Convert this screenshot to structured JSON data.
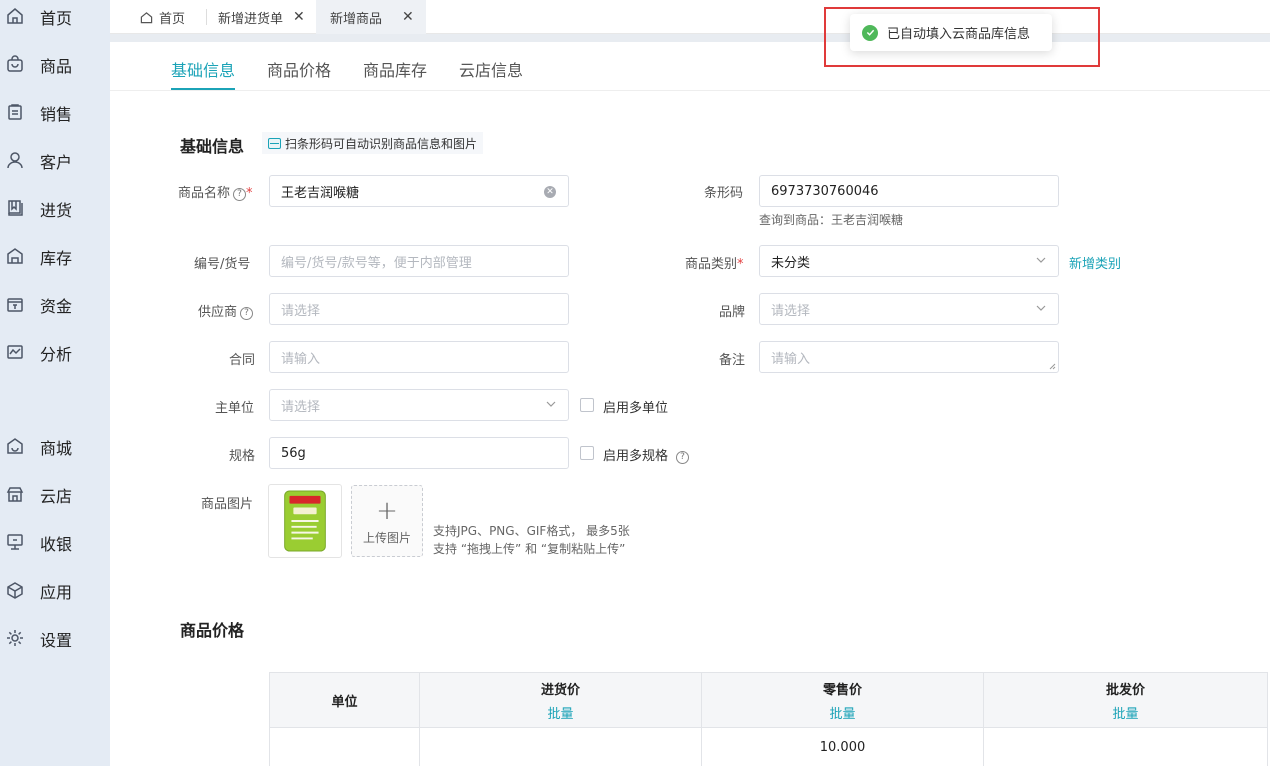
{
  "sidebar": {
    "items": [
      {
        "label": "首页",
        "icon": "home-icon"
      },
      {
        "label": "商品",
        "icon": "bag-icon"
      },
      {
        "label": "销售",
        "icon": "clipboard-icon"
      },
      {
        "label": "客户",
        "icon": "user-icon"
      },
      {
        "label": "进货",
        "icon": "book-icon"
      },
      {
        "label": "库存",
        "icon": "warehouse-icon"
      },
      {
        "label": "资金",
        "icon": "wallet-icon"
      },
      {
        "label": "分析",
        "icon": "chart-icon"
      },
      {
        "label": "商城",
        "icon": "shop-icon"
      },
      {
        "label": "云店",
        "icon": "store-icon"
      },
      {
        "label": "收银",
        "icon": "monitor-icon"
      },
      {
        "label": "应用",
        "icon": "cube-icon"
      },
      {
        "label": "设置",
        "icon": "gear-icon"
      }
    ]
  },
  "tabs": {
    "home": "首页",
    "purchase": "新增进货单",
    "new_product": "新增商品",
    "close": "✕"
  },
  "subtabs": [
    "基础信息",
    "商品价格",
    "商品库存",
    "云店信息"
  ],
  "basic": {
    "title": "基础信息",
    "scan_hint": "扫条形码可自动识别商品信息和图片",
    "name_label": "商品名称",
    "name_value": "王老吉润喉糖",
    "barcode_label": "条形码",
    "barcode_value": "6973730760046",
    "barcode_note": "查询到商品：王老吉润喉糖",
    "code_label": "编号/货号",
    "code_placeholder": "编号/货号/款号等，便于内部管理",
    "category_label": "商品类别",
    "category_value": "未分类",
    "add_category": "新增类别",
    "supplier_label": "供应商",
    "supplier_placeholder": "请选择",
    "brand_label": "品牌",
    "brand_placeholder": "请选择",
    "contract_label": "合同",
    "contract_placeholder": "请输入",
    "remark_label": "备注",
    "remark_placeholder": "请输入",
    "unit_label": "主单位",
    "unit_placeholder": "请选择",
    "multi_unit": "启用多单位",
    "spec_label": "规格",
    "spec_value": "56g",
    "multi_spec": "启用多规格",
    "image_label": "商品图片",
    "upload_label": "上传图片",
    "upload_note1": "支持JPG、PNG、GIF格式， 最多5张",
    "upload_note2": "支持 “拖拽上传” 和 “复制粘贴上传”"
  },
  "price": {
    "title": "商品价格",
    "headers": [
      "单位",
      "进货价",
      "零售价",
      "批发价"
    ],
    "bulk": "批量",
    "row": [
      "",
      "",
      "10.000",
      ""
    ]
  },
  "toast": {
    "message": "已自动填入云商品库信息"
  },
  "colors": {
    "accent": "#1ba3b7",
    "success": "#4fb85a",
    "highlight_border": "#e03a3a",
    "sidebar_bg": "#e4ebf4"
  }
}
